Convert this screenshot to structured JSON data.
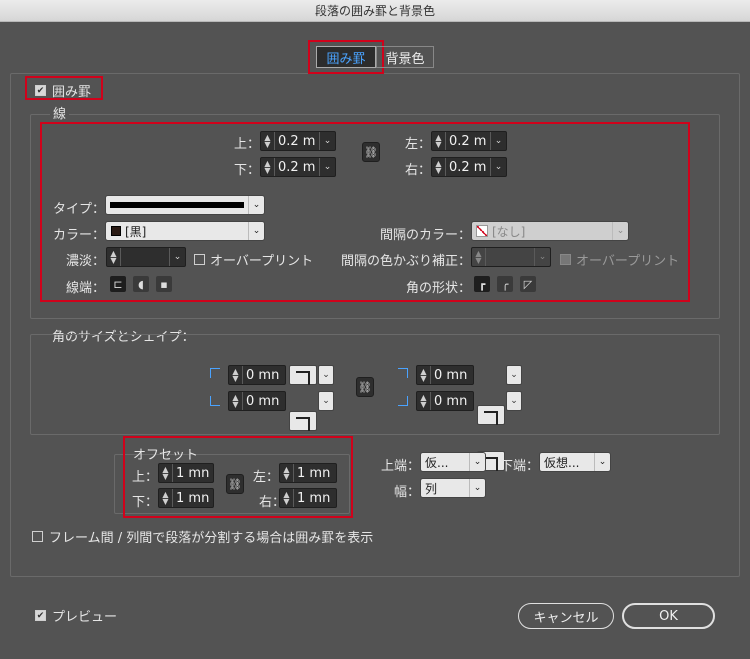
{
  "window": {
    "title": "段落の囲み罫と背景色"
  },
  "tabs": [
    {
      "label": "囲み罫",
      "active": true
    },
    {
      "label": "背景色",
      "active": false
    }
  ],
  "border_enable": {
    "label": "囲み罫",
    "checked": true
  },
  "stroke_section": {
    "title": "線",
    "top_label": "上：",
    "top_value": "0.2 m",
    "bottom_label": "下：",
    "bottom_value": "0.2 m",
    "left_label": "左：",
    "left_value": "0.2 m",
    "right_label": "右：",
    "right_value": "0.2 m",
    "type_label": "タイプ：",
    "color_label": "カラー：",
    "color_value": "[黒]",
    "tint_label": "濃淡：",
    "overprint_label": "オーバープリント",
    "cap_label": "線端：",
    "gap_color_label": "間隔のカラー：",
    "gap_color_value": "[なし]",
    "gap_tint_label": "間隔の色かぶり補正：",
    "gap_overprint_label": "オーバープリント",
    "corner_shape_label": "角の形状："
  },
  "corner_section": {
    "title": "角のサイズとシェイプ：",
    "tl_value": "0 mn",
    "bl_value": "0 mn",
    "tr_value": "0 mn",
    "br_value": "0 mn"
  },
  "offset_section": {
    "title": "オフセット",
    "top_label": "上：",
    "top_value": "1 mn",
    "bottom_label": "下：",
    "bottom_value": "1 mn",
    "left_label": "左：",
    "left_value": "1 mn",
    "right_label": "右：",
    "right_value": "1 mn"
  },
  "edge_section": {
    "top_edge_label": "上端：",
    "top_edge_value": "仮...",
    "bottom_edge_label": "下端：",
    "bottom_edge_value": "仮想...",
    "width_label": "幅：",
    "width_value": "列"
  },
  "split_option": {
    "label": "フレーム間 / 列間で段落が分割する場合は囲み罫を表示",
    "checked": false
  },
  "preview": {
    "label": "プレビュー",
    "checked": true
  },
  "buttons": {
    "cancel": "キャンセル",
    "ok": "OK"
  },
  "colors": {
    "highlight": "#d0021b",
    "tab_active": "#4aa3ff",
    "swatch_black": "#2a1a14"
  }
}
